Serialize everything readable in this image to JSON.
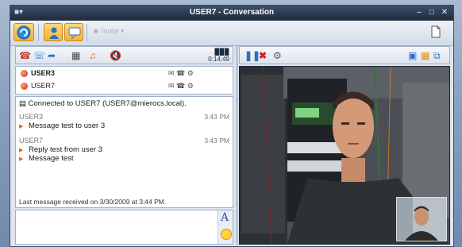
{
  "window": {
    "title": "USER7 - Conversation"
  },
  "toolbar": {
    "invite_label": "Invite"
  },
  "call": {
    "timer_label": "0:14:49"
  },
  "participants": [
    {
      "name": "USER3",
      "bold": true,
      "status_color": "#e0361a"
    },
    {
      "name": "USER7",
      "bold": false,
      "status_color": "#e0361a"
    }
  ],
  "conversation": {
    "connected_text": "Connected to USER7 (USER7@mierocs.local).",
    "messages": [
      {
        "sender": "USER3",
        "time": "3:43 PM",
        "lines": [
          "Message test to user 3"
        ]
      },
      {
        "sender": "USER7",
        "time": "3:43 PM",
        "lines": [
          "Reply test from user 3",
          "Message test"
        ]
      }
    ],
    "last_message_text": "Last message received on 3/30/2009 at 3:44 PM."
  },
  "input": {
    "font_button_label": "A"
  },
  "colors": {
    "accent_orange": "#f3b235",
    "title_bar": "#1f2a3b",
    "status_red": "#e0361a"
  }
}
